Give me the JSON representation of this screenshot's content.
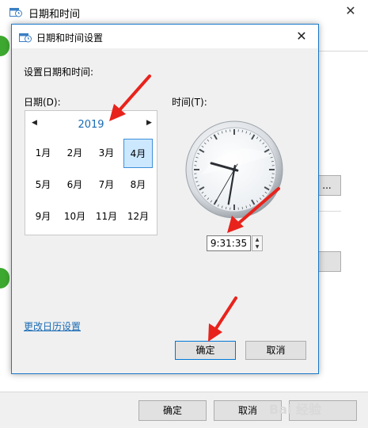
{
  "outer_window": {
    "title": "日期和时间",
    "close_label": "✕",
    "partial_button_label": "...",
    "ok_label": "确定",
    "cancel_label": "取消"
  },
  "dialog": {
    "title": "日期和时间设置",
    "close_label": "✕",
    "section_label": "设置日期和时间:",
    "date_label": "日期(D):",
    "time_label": "时间(T):",
    "calendar": {
      "year": "2019",
      "prev_label": "◀",
      "next_label": "▶",
      "months": [
        "1月",
        "2月",
        "3月",
        "4月",
        "5月",
        "6月",
        "7月",
        "8月",
        "9月",
        "10月",
        "11月",
        "12月"
      ],
      "selected_month": "4月"
    },
    "clock": {
      "hour": 9,
      "minute": 31,
      "second": 35
    },
    "time_value": "9:31:35",
    "change_calendar_link": "更改日历设置",
    "ok_label": "确定",
    "cancel_label": "取消"
  },
  "watermark": "Bai 经验",
  "colors": {
    "accent": "#1979ca",
    "arrow": "#e8231c",
    "link": "#1a6bb5",
    "selected_bg": "#cce8ff",
    "green": "#3da82f"
  }
}
